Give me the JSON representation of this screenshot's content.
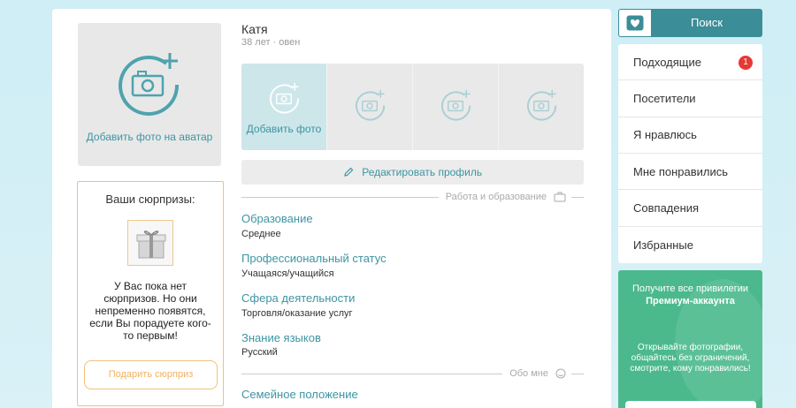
{
  "avatar": {
    "add_label": "Добавить фото на аватар"
  },
  "surprises": {
    "title": "Ваши сюрпризы:",
    "empty_text": "У Вас пока нет сюрпризов. Но они непременно появятся, если Вы порадуете кого-то первым!",
    "button_label": "Подарить сюрприз"
  },
  "profile": {
    "name": "Катя",
    "meta": "38 лет · овен",
    "add_photo_label": "Добавить фото",
    "edit_label": "Редактировать профиль"
  },
  "sections": {
    "work": "Работа и образование",
    "about": "Обо мне"
  },
  "fields": [
    {
      "label": "Образование",
      "value": "Среднее"
    },
    {
      "label": "Профессиональный статус",
      "value": "Учащаяся/учащийся"
    },
    {
      "label": "Сфера деятельности",
      "value": "Торговля/оказание услуг"
    },
    {
      "label": "Знание языков",
      "value": "Русский"
    },
    {
      "label": "Семейное положение",
      "value": ""
    }
  ],
  "search": {
    "label": "Поиск"
  },
  "menu": {
    "items": [
      {
        "label": "Подходящие",
        "badge": "1"
      },
      {
        "label": "Посетители"
      },
      {
        "label": "Я нравлюсь"
      },
      {
        "label": "Мне понравились"
      },
      {
        "label": "Совпадения"
      },
      {
        "label": "Избранные"
      }
    ]
  },
  "premium": {
    "title": "Получите все привилегии",
    "name": "Премиум-аккаунта",
    "description": "Открывайте фотографии, общайтесь без ограничений, смотрите, кому понравились!"
  },
  "colors": {
    "accent": "#3c95a3",
    "search_bg": "#3b8d98",
    "surprise_border": "#f3c07a",
    "badge": "#e53935",
    "premium_bg": "#4bb98c"
  }
}
